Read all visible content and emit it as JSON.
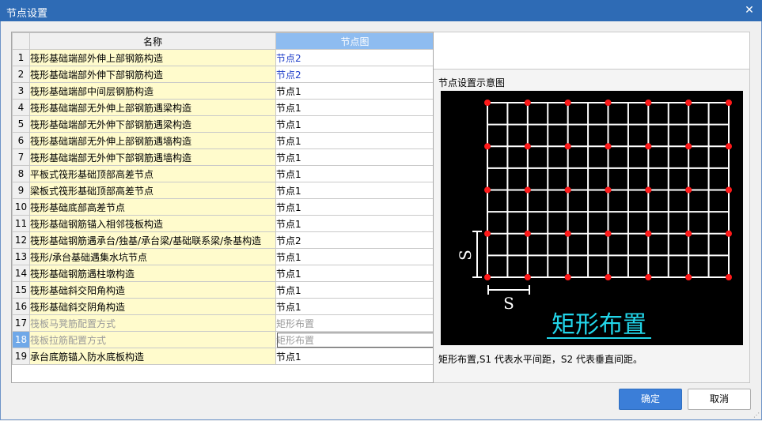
{
  "window": {
    "title": "节点设置",
    "close_glyph": "✕"
  },
  "table": {
    "headers": {
      "num": "",
      "name": "名称",
      "node": "节点图"
    },
    "rows": [
      {
        "num": "1",
        "name": "筏形基础端部外伸上部钢筋构造",
        "value": "节点2"
      },
      {
        "num": "2",
        "name": "筏形基础端部外伸下部钢筋构造",
        "value": "节点2"
      },
      {
        "num": "3",
        "name": "筏形基础端部中间层钢筋构造",
        "value": "节点1"
      },
      {
        "num": "4",
        "name": "筏形基础端部无外伸上部钢筋遇梁构造",
        "value": "节点1"
      },
      {
        "num": "5",
        "name": "筏形基础端部无外伸下部钢筋遇梁构造",
        "value": "节点1"
      },
      {
        "num": "6",
        "name": "筏形基础端部无外伸上部钢筋遇墙构造",
        "value": "节点1"
      },
      {
        "num": "7",
        "name": "筏形基础端部无外伸下部钢筋遇墙构造",
        "value": "节点1"
      },
      {
        "num": "8",
        "name": "平板式筏形基础顶部高差节点",
        "value": "节点1"
      },
      {
        "num": "9",
        "name": "梁板式筏形基础顶部高差节点",
        "value": "节点1"
      },
      {
        "num": "10",
        "name": "筏形基础底部高差节点",
        "value": "节点1"
      },
      {
        "num": "11",
        "name": "筏形基础钢筋锚入相邻筏板构造",
        "value": "节点1"
      },
      {
        "num": "12",
        "name": "筏形基础钢筋遇承台/独基/承台梁/基础联系梁/条基构造",
        "value": "节点2"
      },
      {
        "num": "13",
        "name": "筏形/承台基础遇集水坑节点",
        "value": "节点1"
      },
      {
        "num": "14",
        "name": "筏形基础钢筋遇柱墩构造",
        "value": "节点1"
      },
      {
        "num": "15",
        "name": "筏形基础斜交阳角构造",
        "value": "节点1"
      },
      {
        "num": "16",
        "name": "筏形基础斜交阴角构造",
        "value": "节点1"
      },
      {
        "num": "17",
        "name": "筏板马凳筋配置方式",
        "value": "矩形布置"
      },
      {
        "num": "18",
        "name": "筏板拉筋配置方式",
        "value": "矩形布置"
      },
      {
        "num": "19",
        "name": "承台底筋锚入防水底板构造",
        "value": "节点1"
      }
    ]
  },
  "preview": {
    "label": "节点设置示意图",
    "spacing_label": "S",
    "caption": "矩形布置",
    "description": "矩形布置,S1 代表水平间距，S2 代表垂直间距。",
    "colors": {
      "background": "#000000",
      "grid": "#ffffff",
      "dot": "#ff1a1a",
      "caption": "#22d6ea"
    }
  },
  "buttons": {
    "ok": "确定",
    "cancel": "取消"
  },
  "colors": {
    "titlebar": "#2e6bb5",
    "name_cell": "#fffbcc",
    "link_value": "#1f3ec9",
    "selected_header": "#8ebcf0",
    "primary_button": "#3b7ed8"
  }
}
